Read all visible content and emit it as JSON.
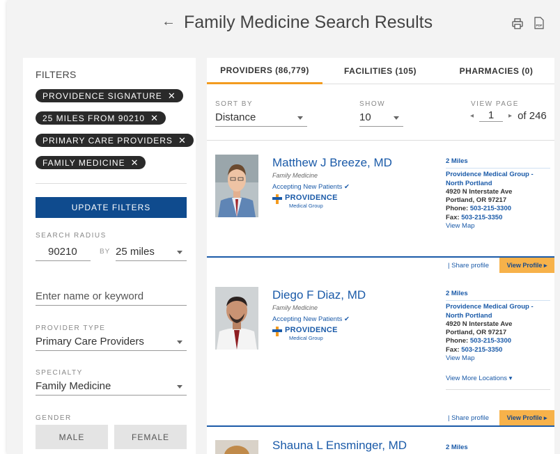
{
  "header": {
    "title": "Family Medicine Search Results",
    "back_icon": "←"
  },
  "filters": {
    "title": "FILTERS",
    "chips": [
      "PROVIDENCE SIGNATURE",
      "25 MILES FROM 90210",
      "PRIMARY CARE PROVIDERS",
      "FAMILY MEDICINE"
    ],
    "chip_remove": "✕",
    "update_button": "UPDATE FILTERS",
    "search_radius_label": "SEARCH RADIUS",
    "zip_value": "90210",
    "by_label": "BY",
    "radius_value": "25 miles",
    "keyword_placeholder": "Enter name or keyword",
    "provider_type_label": "PROVIDER TYPE",
    "provider_type_value": "Primary Care Providers",
    "specialty_label": "SPECIALTY",
    "specialty_value": "Family Medicine",
    "gender_label": "GENDER",
    "gender_male": "MALE",
    "gender_female": "FEMALE"
  },
  "results": {
    "tabs": [
      {
        "label": "PROVIDERS (86,779)",
        "active": true
      },
      {
        "label": "FACILITIES (105)",
        "active": false
      },
      {
        "label": "PHARMACIES (0)",
        "active": false
      }
    ],
    "sort_label": "SORT BY",
    "sort_value": "Distance",
    "show_label": "SHOW",
    "show_value": "10",
    "view_page_label": "VIEW PAGE",
    "page_current": "1",
    "page_total": "of 246",
    "providers": [
      {
        "name": "Matthew J Breeze, MD",
        "specialty": "Family Medicine",
        "accepting": "Accepting New Patients ✔",
        "brand": "PROVIDENCE",
        "brand_sub": "Medical Group",
        "distance": "2 Miles",
        "group": "Providence Medical Group - North Portland",
        "address1": "4920 N Interstate Ave",
        "address2": "Portland, OR 97217",
        "phone_label": "Phone:",
        "phone": "503-215-3300",
        "fax_label": "Fax:",
        "fax": "503-215-3350",
        "map": "View Map",
        "share": "| Share profile",
        "view_profile": "View Profile ▸"
      },
      {
        "name": "Diego F Diaz, MD",
        "specialty": "Family Medicine",
        "accepting": "Accepting New Patients ✔",
        "brand": "PROVIDENCE",
        "brand_sub": "Medical Group",
        "distance": "2 Miles",
        "group": "Providence Medical Group - North Portland",
        "address1": "4920 N Interstate Ave",
        "address2": "Portland, OR 97217",
        "phone_label": "Phone:",
        "phone": "503-215-3300",
        "fax_label": "Fax:",
        "fax": "503-215-3350",
        "map": "View Map",
        "more_locations": "View More Locations ▾",
        "share": "| Share profile",
        "view_profile": "View Profile ▸"
      },
      {
        "name": "Shauna L Ensminger, MD",
        "distance": "2 Miles"
      }
    ]
  },
  "colors": {
    "primary_blue": "#0f4b8e",
    "link_blue": "#1a5aa8",
    "accent_orange": "#f39b1f",
    "button_orange": "#f7b24a"
  }
}
